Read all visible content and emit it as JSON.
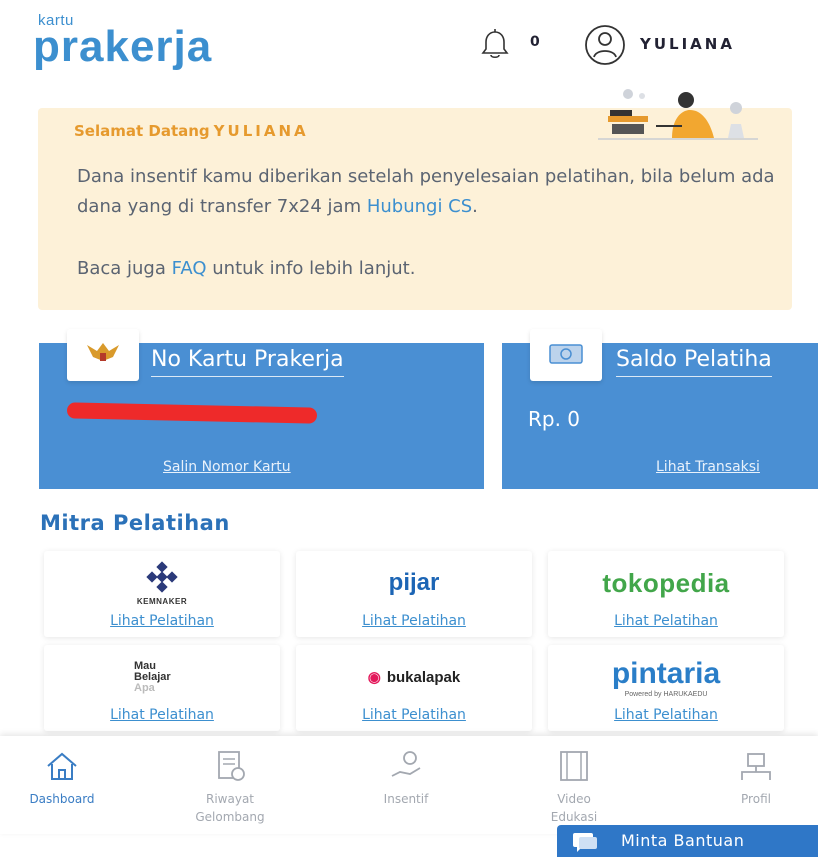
{
  "header": {
    "logo_small": "kartu",
    "logo_big": "prakerja",
    "notification_count": "0",
    "user_name": "YULIANA"
  },
  "welcome": {
    "title_prefix": "Selamat Datang",
    "title_name": "YULIANA",
    "body_text": "Dana insentif kamu diberikan setelah penyelesaian pelatihan, bila belum ada dana yang di transfer 7x24 jam",
    "cs_link": "Hubungi CS",
    "cs_suffix": ".",
    "faq_prefix": "Baca juga",
    "faq_link": "FAQ",
    "faq_suffix": "untuk info lebih lanjut."
  },
  "cards": {
    "kartu": {
      "title": "No Kartu Prakerja",
      "link": "Salin Nomor Kartu"
    },
    "saldo": {
      "title": "Saldo Pelatiha",
      "amount": "Rp. 0",
      "link": "Lihat Transaksi"
    }
  },
  "mitra": {
    "title": "Mitra Pelatihan",
    "partners": [
      {
        "name": "KEMNAKER",
        "link": "Lihat Pelatihan"
      },
      {
        "name": "pijar",
        "link": "Lihat Pelatihan"
      },
      {
        "name": "tokopedia",
        "link": "Lihat Pelatihan"
      },
      {
        "name": "Mau Belajar Apa",
        "line1": "Mau",
        "line2": "Belajar",
        "line3": "Apa",
        "link": "Lihat Pelatihan"
      },
      {
        "name": "bukalapak",
        "link": "Lihat Pelatihan"
      },
      {
        "name": "pintaria",
        "subtext": "Powered by HARUKAEDU",
        "link": "Lihat Pelatihan"
      }
    ]
  },
  "bottom_nav": {
    "items": [
      {
        "label": "Dashboard",
        "icon": "home-icon",
        "active": true
      },
      {
        "label_line1": "Riwayat",
        "label_line2": "Gelombang",
        "icon": "history-icon",
        "active": false
      },
      {
        "label": "Insentif",
        "icon": "incentive-icon",
        "active": false
      },
      {
        "label_line1": "Video",
        "label_line2": "Edukasi",
        "icon": "video-icon",
        "active": false
      },
      {
        "label": "Profil",
        "icon": "profile-icon",
        "active": false
      }
    ]
  },
  "help_button": {
    "label": "Minta Bantuan",
    "icon": "chat-icon"
  },
  "colors": {
    "brand_blue": "#3c8fcf",
    "card_blue": "#4a8fd3",
    "banner_bg": "#fdf1d8",
    "banner_accent": "#e69a2e",
    "redaction": "#ee2a2a"
  }
}
